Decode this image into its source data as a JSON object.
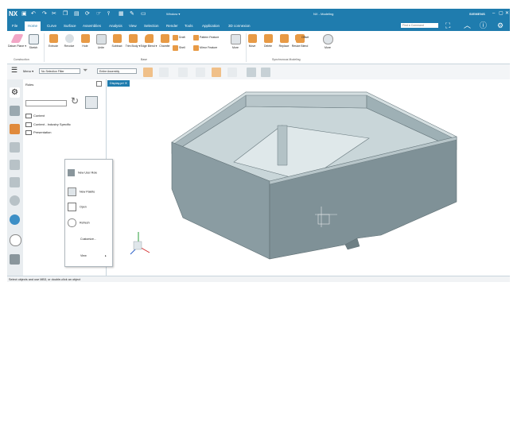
{
  "titlebar": {
    "logo": "NX",
    "window_selector": "Window ▾",
    "app_title": "NX - Modeling",
    "brand": "SIEMENS"
  },
  "menu_tabs": [
    "File",
    "Home",
    "Curve",
    "Surface",
    "Assemblies",
    "Analysis",
    "View",
    "Selection",
    "Render",
    "Tools",
    "Application",
    "3D connexion"
  ],
  "active_tab": "Home",
  "search": {
    "placeholder": "Find a Command"
  },
  "ribbon": {
    "datum_plane": "Datum Plane ▾",
    "sketch": "Sketch",
    "extrude": "Extrude",
    "revolve": "Revolve",
    "hole": "Hole",
    "unite": "Unite",
    "subtract": "Subtract",
    "trim_body": "Trim Body ▾",
    "edge_blend": "Edge Blend ▾",
    "chamfer": "Chamfer",
    "draft": "Draft",
    "shell": "Shell",
    "pattern_feature": "Pattern Feature",
    "mirror_feature": "Mirror Feature",
    "more": "More",
    "move": "Move",
    "delete": "Delete",
    "replace": "Replace",
    "resize_blend": "Resize Blend",
    "offset": "Offset",
    "more2": "More",
    "group_construction": "Construction",
    "group_base": "Base",
    "group_sync": "Synchronous Modeling"
  },
  "toolbar": {
    "menu": "Menu ▾",
    "filter": "No Selection Filter",
    "scope": "Entire Assembly"
  },
  "panel": {
    "title": "Roles",
    "items": [
      "Content",
      "Content - Industry Specific",
      "Presentation"
    ]
  },
  "context_menu": {
    "items": [
      "New User Role",
      "New Palette",
      "Open",
      "Refresh",
      "Customize...",
      "View"
    ]
  },
  "graphics_tab": "Display.prt ✕",
  "status": "Select objects and use MB3, or double-click an object",
  "colors": {
    "accent": "#1f7cae",
    "part_face_dark": "#7f9197",
    "part_face_light": "#a9b9be",
    "part_inner": "#c9d6d9"
  }
}
